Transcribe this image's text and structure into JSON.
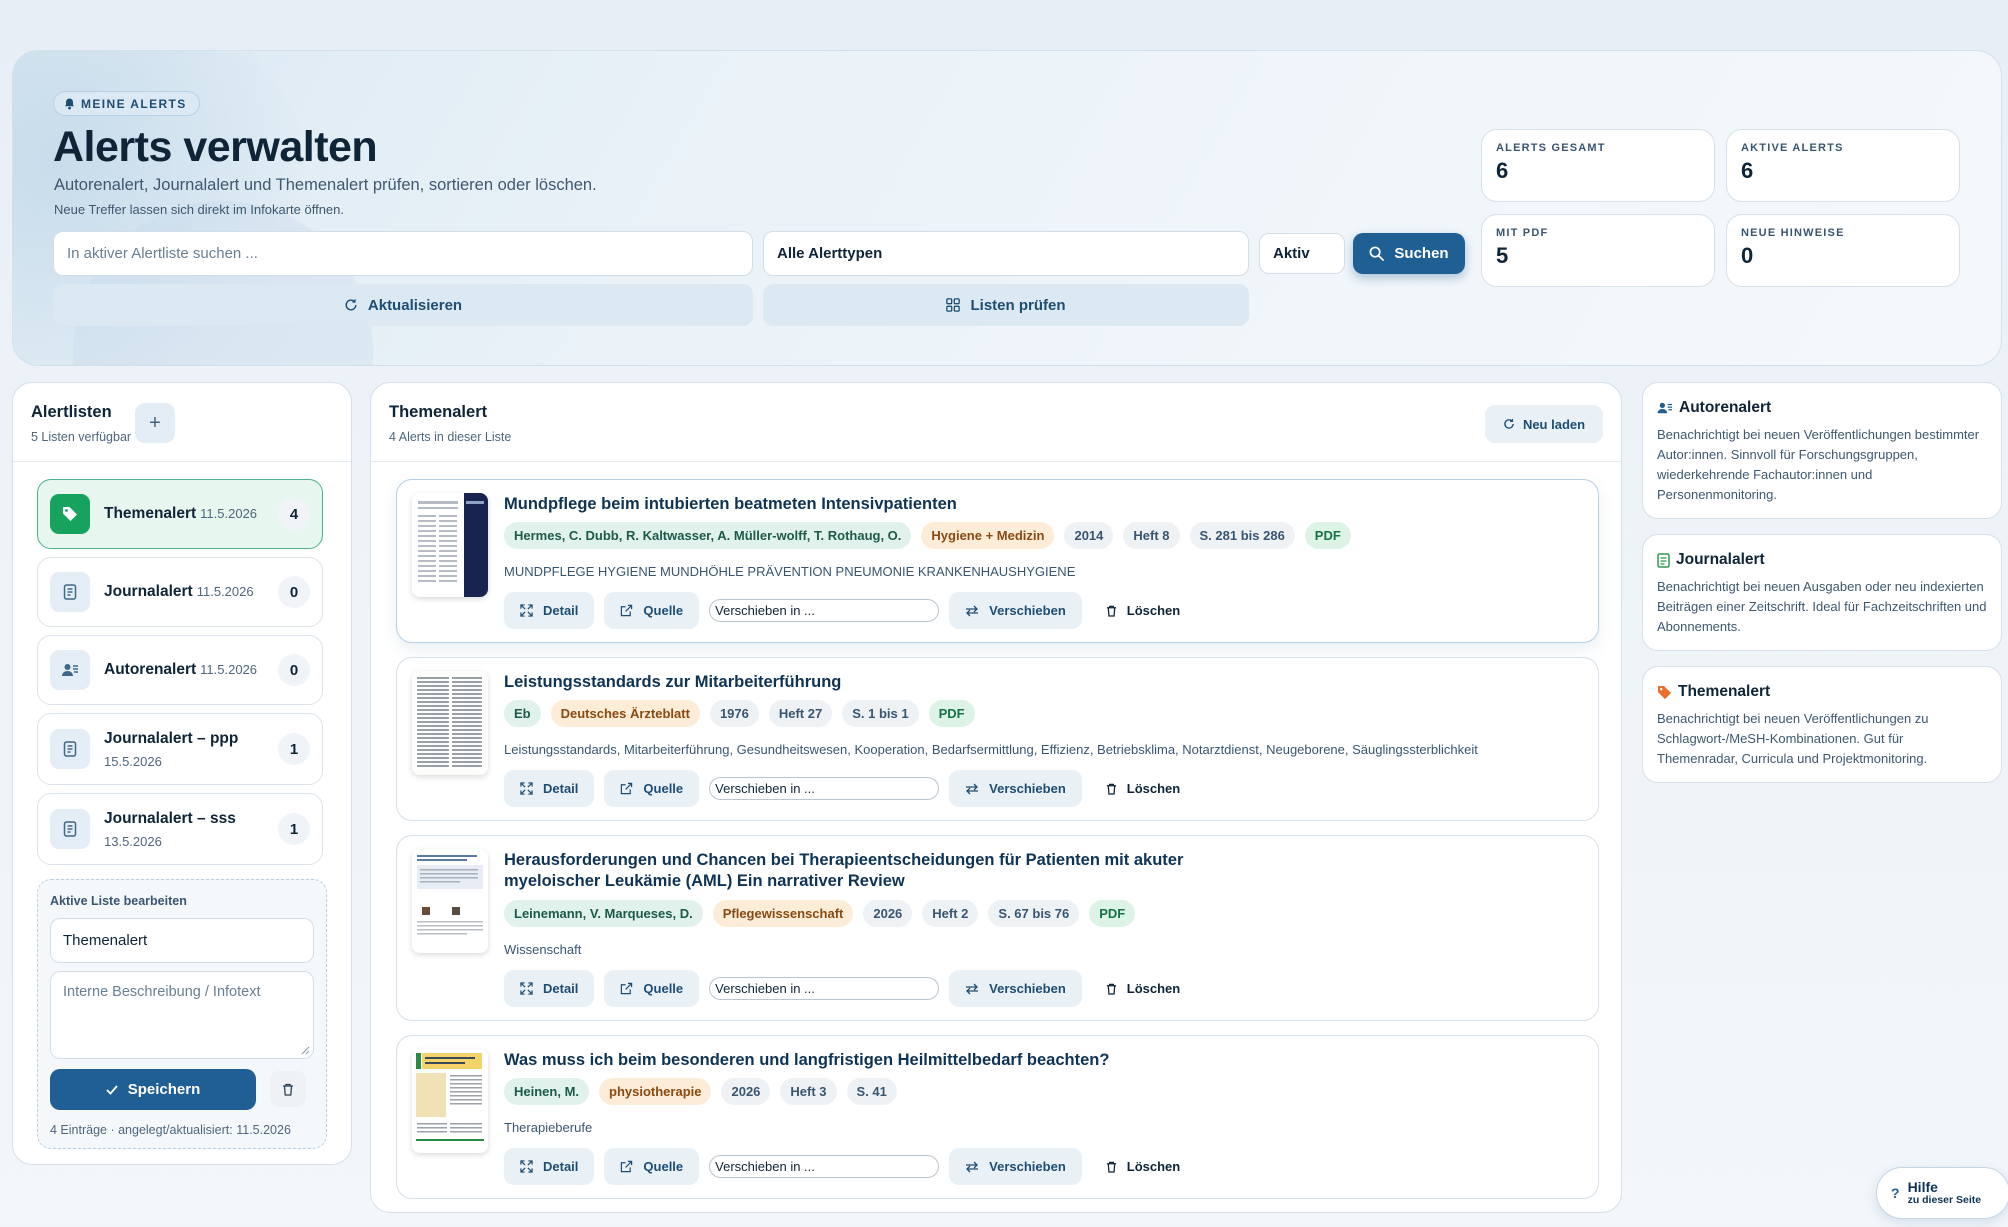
{
  "hero": {
    "badge": "MEINE ALERTS",
    "title": "Alerts verwalten",
    "subtitle": "Autorenalert, Journalalert und Themenalert prüfen, sortieren oder löschen.",
    "note": "Neue Treffer lassen sich direkt im Infokarte öffnen.",
    "search_placeholder": "In aktiver Alertliste suchen ...",
    "type_select": "Alle Alerttypen",
    "status_select": "Aktiv",
    "search_button": "Suchen",
    "refresh_button": "Aktualisieren",
    "check_button": "Listen prüfen"
  },
  "stats": [
    {
      "label": "ALERTS GESAMT",
      "value": "6"
    },
    {
      "label": "AKTIVE ALERTS",
      "value": "6"
    },
    {
      "label": "MIT PDF",
      "value": "5"
    },
    {
      "label": "NEUE HINWEISE",
      "value": "0"
    }
  ],
  "sidebar": {
    "title": "Alertlisten",
    "subtitle": "5 Listen verfügbar",
    "add_label": "+",
    "items": [
      {
        "name": "Themenalert",
        "date": "11.5.2026",
        "count": "4",
        "icon": "tag-icon"
      },
      {
        "name": "Journalalert",
        "date": "11.5.2026",
        "count": "0",
        "icon": "journal-icon"
      },
      {
        "name": "Autorenalert",
        "date": "11.5.2026",
        "count": "0",
        "icon": "author-icon"
      },
      {
        "name": "Journalalert – ppp",
        "date": "15.5.2026",
        "count": "1",
        "icon": "journal-icon"
      },
      {
        "name": "Journalalert – sss",
        "date": "13.5.2026",
        "count": "1",
        "icon": "journal-icon"
      }
    ],
    "edit": {
      "label": "Aktive Liste bearbeiten",
      "name_value": "Themenalert",
      "desc_placeholder": "Interne Beschreibung / Infotext",
      "save_label": "Speichern",
      "footer": "4 Einträge · angelegt/aktualisiert: 11.5.2026"
    }
  },
  "main": {
    "title": "Themenalert",
    "subtitle": "4 Alerts in dieser Liste",
    "reload_label": "Neu laden",
    "action_labels": {
      "detail": "Detail",
      "source": "Quelle",
      "move_placeholder": "Verschieben in ...",
      "move": "Verschieben",
      "delete": "Löschen"
    },
    "alerts": [
      {
        "title": "Mundpflege beim intubierten beatmeten Intensivpatienten",
        "authors": "Hermes, C. Dubb, R. Kaltwasser, A. Müller-wolff, T. Rothaug, O.",
        "source": "Hygiene + Medizin",
        "year": "2014",
        "issue": "Heft 8",
        "pages": "S. 281 bis 286",
        "pdf": "PDF",
        "keywords": "MUNDPFLEGE HYGIENE MUNDHÖHLE PRÄVENTION PNEUMONIE KRANKENHAUSHYGIENE"
      },
      {
        "title": "Leistungsstandards zur Mitarbeiterführung",
        "authors": "Eb",
        "source": "Deutsches Ärzteblatt",
        "year": "1976",
        "issue": "Heft 27",
        "pages": "S. 1 bis 1",
        "pdf": "PDF",
        "keywords": "Leistungsstandards, Mitarbeiterführung, Gesundheitswesen, Kooperation, Bedarfsermittlung, Effizienz, Betriebsklima, Notarztdienst, Neugeborene, Säuglingssterblichkeit"
      },
      {
        "title": "Herausforderungen und Chancen bei Therapieentscheidungen für Patienten mit akuter myeloischer Leukämie (AML) Ein narrativer Review",
        "authors": "Leinemann, V. Marqueses, D.",
        "source": "Pflegewissenschaft",
        "year": "2026",
        "issue": "Heft 2",
        "pages": "S. 67 bis 76",
        "pdf": "PDF",
        "keywords": "Wissenschaft"
      },
      {
        "title": "Was muss ich beim besonderen und langfristigen Heilmittelbedarf beachten?",
        "authors": "Heinen, M.",
        "source": "physiotherapie",
        "year": "2026",
        "issue": "Heft 3",
        "pages": "S. 41",
        "pdf": "",
        "keywords": "Therapieberufe"
      }
    ]
  },
  "info_cards": [
    {
      "title": "Autorenalert",
      "text": "Benachrichtigt bei neuen Veröffentlichungen bestimmter Autor:innen. Sinnvoll für Forschungsgruppen, wiederkehrende Fachautor:innen und Personenmonitoring.",
      "icon": "author-icon"
    },
    {
      "title": "Journalalert",
      "text": "Benachrichtigt bei neuen Ausgaben oder neu indexierten Beiträgen einer Zeitschrift. Ideal für Fachzeitschriften und Abonnements.",
      "icon": "journal-icon"
    },
    {
      "title": "Themenalert",
      "text": "Benachrichtigt bei neuen Veröffentlichungen zu Schlagwort-/MeSH-Kombinationen. Gut für Themenradar, Curricula und Projektmonitoring.",
      "icon": "tag-icon"
    }
  ],
  "help": {
    "label": "Hilfe",
    "sub": "zu dieser Seite",
    "icon": "?"
  }
}
